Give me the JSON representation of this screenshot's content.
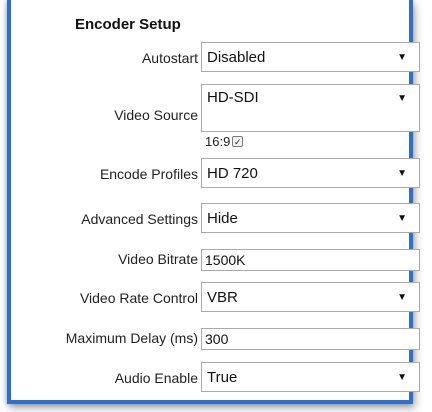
{
  "panel": {
    "title": "Encoder Setup"
  },
  "fields": {
    "autostart": {
      "label": "Autostart",
      "value": "Disabled"
    },
    "video_source": {
      "label": "Video Source",
      "value": "HD-SDI"
    },
    "aspect_ratio": {
      "label": "16:9",
      "checked": true
    },
    "encode_profiles": {
      "label": "Encode Profiles",
      "value": "HD 720"
    },
    "advanced_settings": {
      "label": "Advanced Settings",
      "value": "Hide"
    },
    "video_bitrate": {
      "label": "Video Bitrate",
      "value": "1500K"
    },
    "video_rate_control": {
      "label": "Video Rate Control",
      "value": "VBR"
    },
    "maximum_delay": {
      "label": "Maximum Delay (ms)",
      "value": "300"
    },
    "audio_enable": {
      "label": "Audio Enable",
      "value": "True"
    }
  },
  "icons": {
    "dropdown": "▼",
    "checkmark": "✓"
  },
  "colors": {
    "frame_border": "#2d6fc9"
  }
}
